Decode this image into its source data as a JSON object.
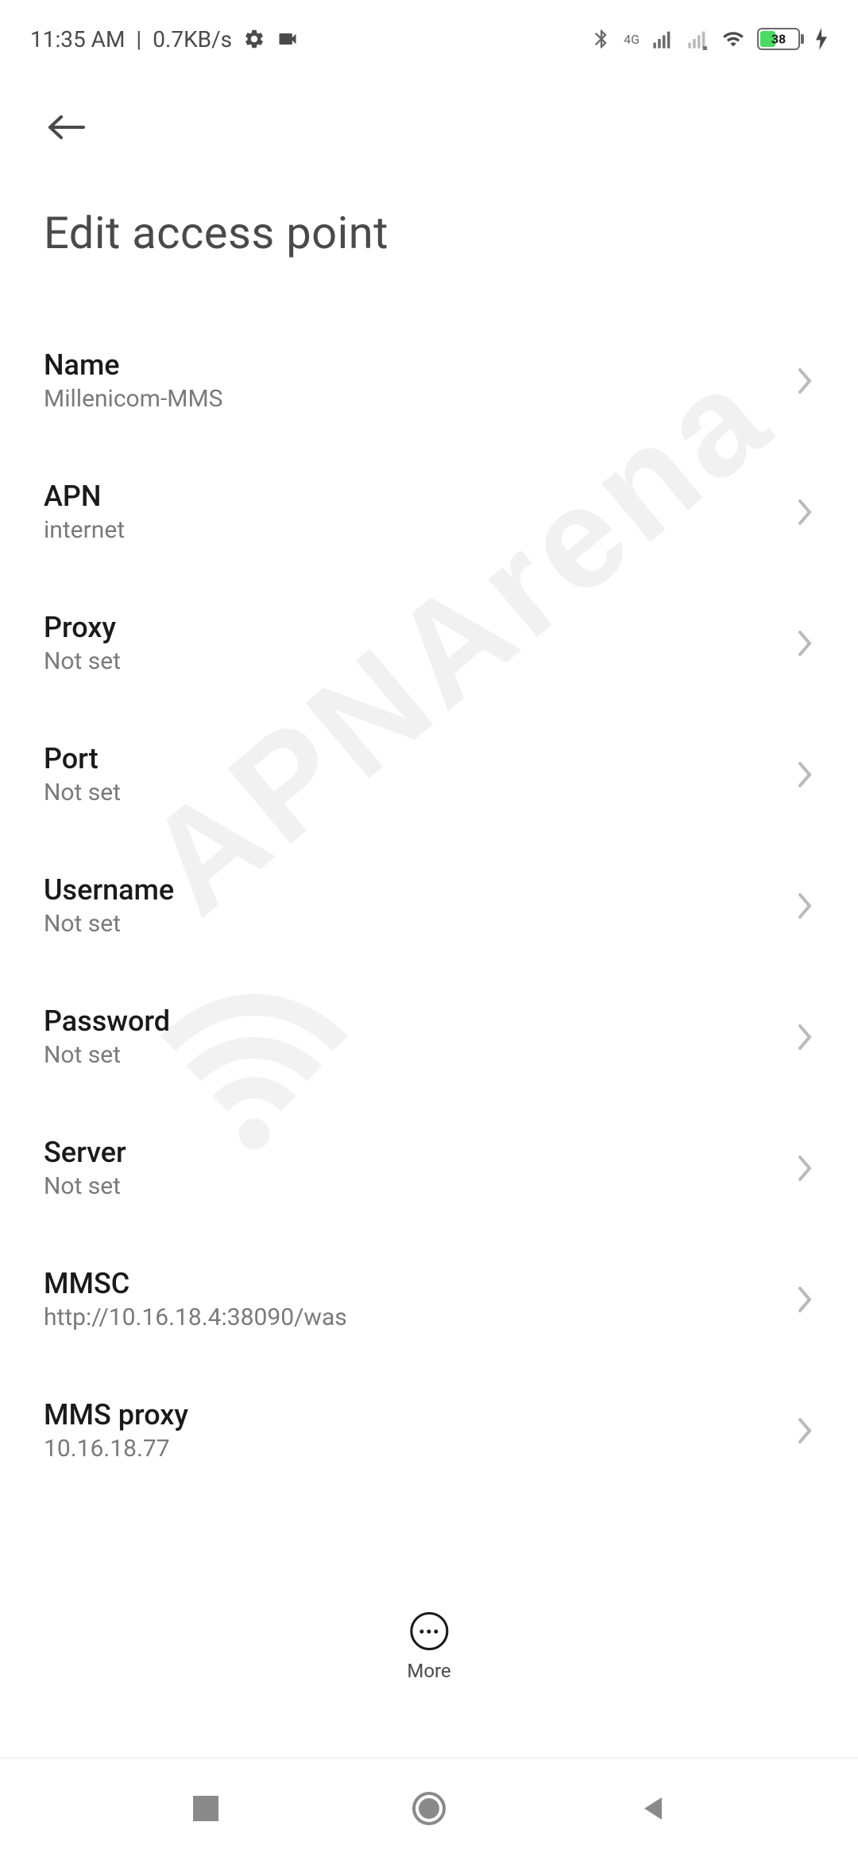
{
  "status": {
    "time": "11:35 AM",
    "data_rate": "0.7KB/s",
    "network_label": "4G",
    "battery_pct": "38"
  },
  "page": {
    "title": "Edit access point"
  },
  "settings": [
    {
      "title": "Name",
      "value": "Millenicom-MMS"
    },
    {
      "title": "APN",
      "value": "internet"
    },
    {
      "title": "Proxy",
      "value": "Not set"
    },
    {
      "title": "Port",
      "value": "Not set"
    },
    {
      "title": "Username",
      "value": "Not set"
    },
    {
      "title": "Password",
      "value": "Not set"
    },
    {
      "title": "Server",
      "value": "Not set"
    },
    {
      "title": "MMSC",
      "value": "http://10.16.18.4:38090/was"
    },
    {
      "title": "MMS proxy",
      "value": "10.16.18.77"
    }
  ],
  "more_button": {
    "label": "More"
  },
  "watermark": {
    "text": "APNArena"
  }
}
